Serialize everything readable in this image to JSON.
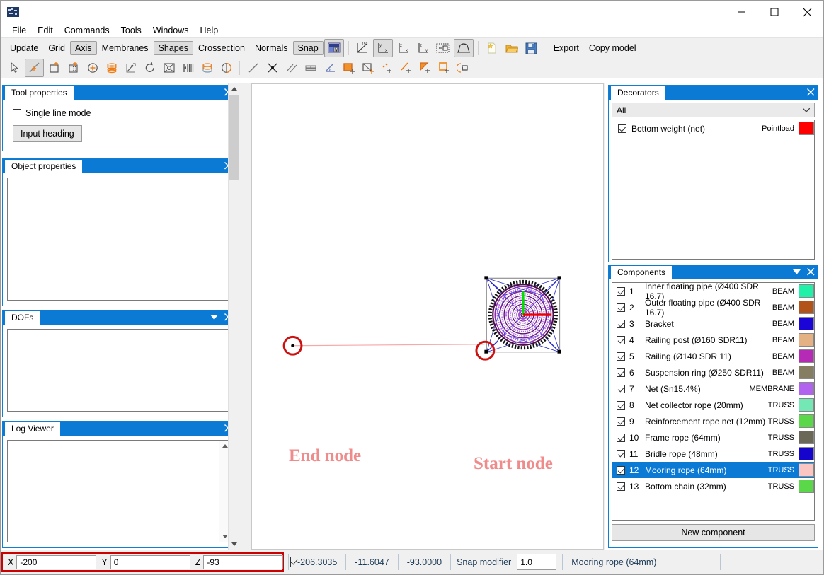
{
  "window": {
    "app_icon": "app-icon",
    "minimize": "–",
    "maximize": "□",
    "close": "✕"
  },
  "menu": {
    "items": [
      "File",
      "Edit",
      "Commands",
      "Tools",
      "Windows",
      "Help"
    ]
  },
  "toolbar_main": {
    "text_buttons": [
      {
        "label": "Update",
        "toggled": false
      },
      {
        "label": "Grid",
        "toggled": false
      },
      {
        "label": "Axis",
        "toggled": true
      },
      {
        "label": "Membranes",
        "toggled": false
      },
      {
        "label": "Shapes",
        "toggled": true
      },
      {
        "label": "Crossection",
        "toggled": false
      },
      {
        "label": "Normals",
        "toggled": false
      },
      {
        "label": "Snap",
        "toggled": true
      }
    ],
    "icon_buttons": [
      {
        "name": "lock-view-icon",
        "toggled": true
      },
      {
        "name": "angle-150-axis-icon",
        "toggled": false
      },
      {
        "name": "axis-yx-icon",
        "toggled": true
      },
      {
        "name": "axis-zx-icon",
        "toggled": false
      },
      {
        "name": "axis-zy-icon",
        "toggled": false
      },
      {
        "name": "fit-view-icon",
        "toggled": false
      },
      {
        "name": "shape-arch-icon",
        "toggled": true
      },
      {
        "name": "new-file-icon",
        "toggled": false
      },
      {
        "name": "open-folder-icon",
        "toggled": false
      },
      {
        "name": "save-disk-icon",
        "toggled": false
      }
    ],
    "export_label": "Export",
    "copy_model_label": "Copy model"
  },
  "toolbar_tools": {
    "icons": [
      {
        "name": "select-arrow-icon",
        "toggled": false
      },
      {
        "name": "draw-line-icon",
        "toggled": true
      },
      {
        "name": "add-rectangle-icon",
        "toggled": false
      },
      {
        "name": "add-grid-icon",
        "toggled": false
      },
      {
        "name": "add-point-icon",
        "toggled": false
      },
      {
        "name": "stack-icon",
        "toggled": false
      },
      {
        "name": "extrude-icon",
        "toggled": false
      },
      {
        "name": "rotate-icon",
        "toggled": false
      },
      {
        "name": "scale-icon",
        "toggled": false
      },
      {
        "name": "divide-icon",
        "toggled": false
      },
      {
        "name": "cylinder-icon",
        "toggled": false
      },
      {
        "name": "half-circle-icon",
        "toggled": false
      },
      {
        "name": "segment-icon",
        "toggled": false
      },
      {
        "name": "intersection-icon",
        "toggled": false
      },
      {
        "name": "parallel-lines-icon",
        "toggled": false
      },
      {
        "name": "measure-icon",
        "toggled": false
      },
      {
        "name": "angle-icon",
        "toggled": false
      },
      {
        "name": "fill-square-icon",
        "toggled": false
      },
      {
        "name": "add-surface-icon",
        "toggled": false
      },
      {
        "name": "add-points-icon",
        "toggled": false
      },
      {
        "name": "add-line-icon",
        "toggled": false
      },
      {
        "name": "add-triangle-icon",
        "toggled": false
      },
      {
        "name": "add-square-icon",
        "toggled": false
      },
      {
        "name": "mirror-icon",
        "toggled": false
      }
    ]
  },
  "left_dock": {
    "tool_properties": {
      "title": "Tool properties",
      "single_line_mode_label": "Single line mode",
      "single_line_mode_checked": false,
      "input_heading_label": "Input heading"
    },
    "object_properties": {
      "title": "Object properties"
    },
    "dofs": {
      "title": "DOFs"
    },
    "log_viewer": {
      "title": "Log Viewer"
    }
  },
  "right_dock": {
    "decorators": {
      "title": "Decorators",
      "filter_value": "All",
      "items": [
        {
          "label": "Bottom weight (net)",
          "type": "Pointload",
          "color": "#fe0000",
          "checked": true
        }
      ]
    },
    "components": {
      "title": "Components",
      "new_component_label": "New component",
      "items": [
        {
          "num": "1",
          "name": "Inner floating pipe (Ø400 SDR 16.7)",
          "type": "BEAM",
          "color": "#21f0a8",
          "checked": true,
          "selected": false
        },
        {
          "num": "2",
          "name": "Outer floating pipe (Ø400 SDR 16.7)",
          "type": "BEAM",
          "color": "#b2531a",
          "checked": true,
          "selected": false
        },
        {
          "num": "3",
          "name": "Bracket",
          "type": "BEAM",
          "color": "#1a04d6",
          "checked": true,
          "selected": false
        },
        {
          "num": "4",
          "name": "Railing post (Ø160 SDR11)",
          "type": "BEAM",
          "color": "#e3b184",
          "checked": true,
          "selected": false
        },
        {
          "num": "5",
          "name": "Railing (Ø140 SDR 11)",
          "type": "BEAM",
          "color": "#b52bb5",
          "checked": true,
          "selected": false
        },
        {
          "num": "6",
          "name": "Suspension ring (Ø250 SDR11)",
          "type": "BEAM",
          "color": "#857e62",
          "checked": true,
          "selected": false
        },
        {
          "num": "7",
          "name": "Net (Sn15.4%)",
          "type": "MEMBRANE",
          "color": "#b163f0",
          "checked": true,
          "selected": false
        },
        {
          "num": "8",
          "name": "Net collector rope (20mm)",
          "type": "TRUSS",
          "color": "#73e8b5",
          "checked": true,
          "selected": false
        },
        {
          "num": "9",
          "name": "Reinforcement rope net (12mm)",
          "type": "TRUSS",
          "color": "#5bd84a",
          "checked": true,
          "selected": false
        },
        {
          "num": "10",
          "name": "Frame rope (64mm)",
          "type": "TRUSS",
          "color": "#6b6857",
          "checked": true,
          "selected": false
        },
        {
          "num": "11",
          "name": "Bridle rope (48mm)",
          "type": "TRUSS",
          "color": "#1404cc",
          "checked": true,
          "selected": false
        },
        {
          "num": "12",
          "name": "Mooring rope (64mm)",
          "type": "TRUSS",
          "color": "#fbc6c2",
          "checked": true,
          "selected": true
        },
        {
          "num": "13",
          "name": "Bottom chain (32mm)",
          "type": "TRUSS",
          "color": "#5bd84a",
          "checked": true,
          "selected": false
        }
      ]
    }
  },
  "canvas": {
    "annotations": [
      {
        "label": "End node",
        "color": "#ef8b8b"
      },
      {
        "label": "Start node",
        "color": "#ef8b8b"
      }
    ]
  },
  "status_bar": {
    "x_label": "X",
    "x_value": "-200",
    "y_label": "Y",
    "y_value": "0",
    "z_label": "Z",
    "z_value": "-93",
    "lock_checked": true,
    "readouts": [
      "-206.3035",
      "-11.6047",
      "-93.0000"
    ],
    "snap_modifier_label": "Snap modifier",
    "snap_modifier_value": "1.0",
    "active_component": "Mooring rope (64mm)"
  }
}
